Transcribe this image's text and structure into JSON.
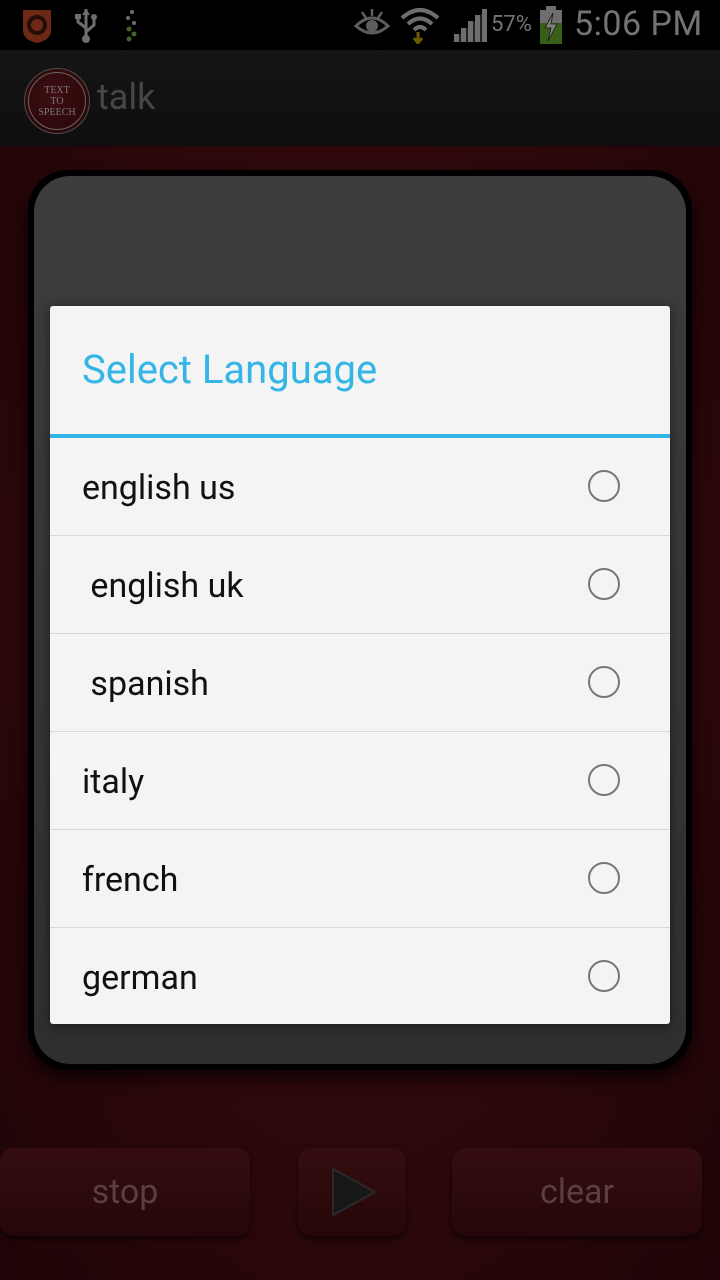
{
  "status_bar": {
    "battery_percent": "57%",
    "time": "5:06 PM",
    "icons": [
      "app-notification-icon",
      "usb-icon",
      "download-icon",
      "eye-icon",
      "wifi-icon",
      "signal-icon",
      "battery-charging-icon"
    ]
  },
  "action_bar": {
    "logo_lines": [
      "TEXT",
      "TO",
      "SPEECH"
    ],
    "title": "talk"
  },
  "controls": {
    "stop_label": "stop",
    "play_icon": "play-icon",
    "clear_label": "clear"
  },
  "dialog": {
    "title": "Select Language",
    "accent_color": "#33b5e5",
    "options": [
      {
        "label": "english us",
        "selected": false
      },
      {
        "label": " english uk",
        "selected": false
      },
      {
        "label": " spanish",
        "selected": false
      },
      {
        "label": "italy",
        "selected": false
      },
      {
        "label": "french",
        "selected": false
      },
      {
        "label": "german",
        "selected": false
      }
    ]
  }
}
